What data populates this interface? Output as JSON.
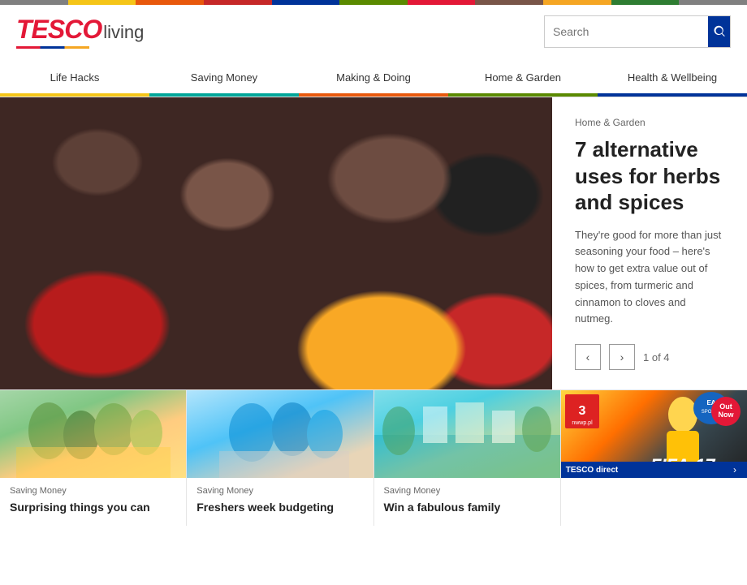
{
  "rainbow": {
    "colors": [
      "#808080",
      "#f5c518",
      "#e8580c",
      "#c62828",
      "#003399",
      "#5a8a00",
      "#e31837",
      "#795548",
      "#f5a623",
      "#2e7d32",
      "#808080"
    ]
  },
  "header": {
    "logo_tesco": "TESCO",
    "logo_living": "living",
    "search_placeholder": "Search",
    "search_button_label": "Search"
  },
  "nav": {
    "items": [
      {
        "label": "Life Hacks",
        "class": "active-yellow"
      },
      {
        "label": "Saving Money",
        "class": "active-teal"
      },
      {
        "label": "Making & Doing",
        "class": "active-orange"
      },
      {
        "label": "Home & Garden",
        "class": "active-green"
      },
      {
        "label": "Health & Wellbeing",
        "class": "active-blue"
      }
    ]
  },
  "hero": {
    "category": "Home & Garden",
    "title": "7 alternative uses for herbs and spices",
    "description": "They're good for more than just seasoning your food – here's how to get extra value out of spices, from turmeric and cinnamon to cloves and nutmeg.",
    "counter": "1 of 4",
    "prev_label": "‹",
    "next_label": "›"
  },
  "cards": [
    {
      "category": "Saving Money",
      "title": "Surprising things you can",
      "img_type": "people"
    },
    {
      "category": "Saving Money",
      "title": "Freshers week budgeting",
      "img_type": "students"
    },
    {
      "category": "Saving Money",
      "title": "Win a fabulous family",
      "img_type": "resort"
    },
    {
      "category": "",
      "title": "",
      "img_type": "fifa",
      "badge_rating": "3",
      "badge_outnow": "Out Now"
    }
  ]
}
